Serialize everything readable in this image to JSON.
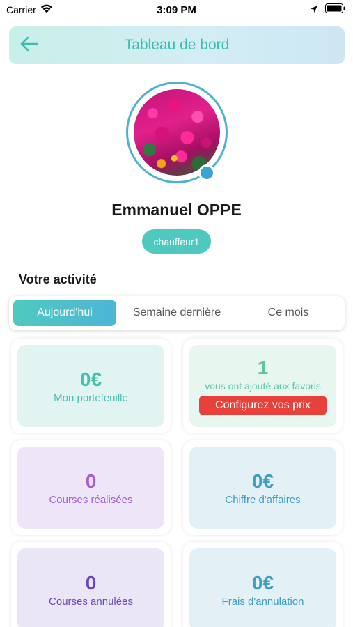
{
  "status_bar": {
    "carrier": "Carrier",
    "time": "3:09 PM"
  },
  "header": {
    "title": "Tableau de bord",
    "back_icon": "arrow-left-icon",
    "background_gradient": [
      "#c9efe9",
      "#cde6f3"
    ],
    "title_color": "#3bbdb0"
  },
  "profile": {
    "name": "Emmanuel OPPE",
    "role": "chauffeur1",
    "online_indicator_color": "#3aa3d2",
    "ring_color": "#4db2cf"
  },
  "activity": {
    "section_title": "Votre activité",
    "tabs": [
      {
        "label": "Aujourd'hui",
        "active": true
      },
      {
        "label": "Semaine dernière",
        "active": false
      },
      {
        "label": "Ce mois",
        "active": false
      }
    ],
    "cards": [
      {
        "value": "0€",
        "label": "Mon portefeuille",
        "color": "#47bfae",
        "background": "#e1f4f1"
      },
      {
        "value": "1",
        "label": "vous ont ajouté aux favoris",
        "button": "Configurez vos prix",
        "color": "#5bc89b",
        "background": "#e7f6ee",
        "button_color": "#e8413b"
      },
      {
        "value": "0",
        "label": "Courses réalisées",
        "color": "#a35ed8",
        "background": "#efe5f8"
      },
      {
        "value": "0€",
        "label": "Chiffre d'affaires",
        "color": "#3d9ec4",
        "background": "#e3f1f7"
      },
      {
        "value": "0",
        "label": "Courses annulées",
        "color": "#6d45be",
        "background": "#ebe6f6"
      },
      {
        "value": "0€",
        "label": "Frais d'annulation",
        "color": "#3d9ec4",
        "background": "#e3f1f7"
      }
    ]
  }
}
